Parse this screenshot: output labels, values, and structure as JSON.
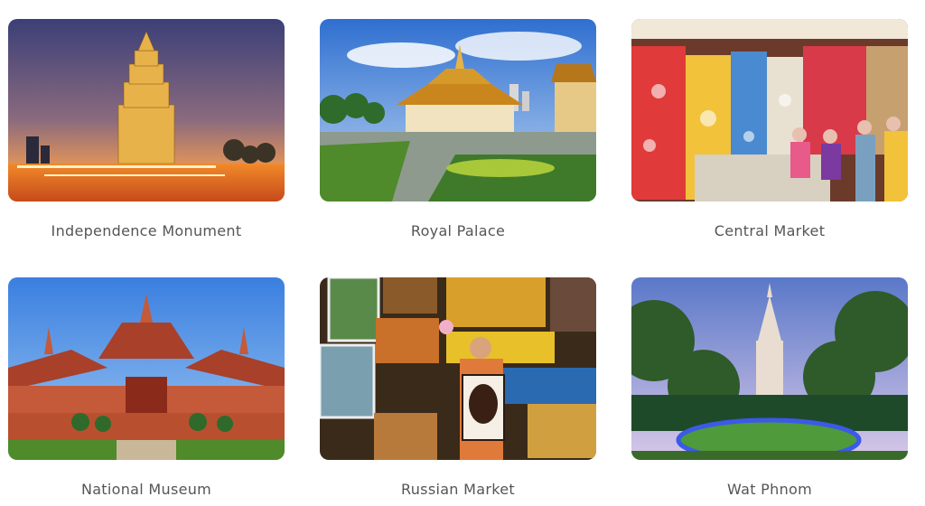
{
  "attractions": [
    {
      "name": "Independence Monument",
      "image": "independence-monument-photo"
    },
    {
      "name": "Royal Palace",
      "image": "royal-palace-photo"
    },
    {
      "name": "Central Market",
      "image": "central-market-photo"
    },
    {
      "name": "National Museum",
      "image": "national-museum-photo"
    },
    {
      "name": "Russian Market",
      "image": "russian-market-photo"
    },
    {
      "name": "Wat Phnom",
      "image": "wat-phnom-photo"
    }
  ]
}
